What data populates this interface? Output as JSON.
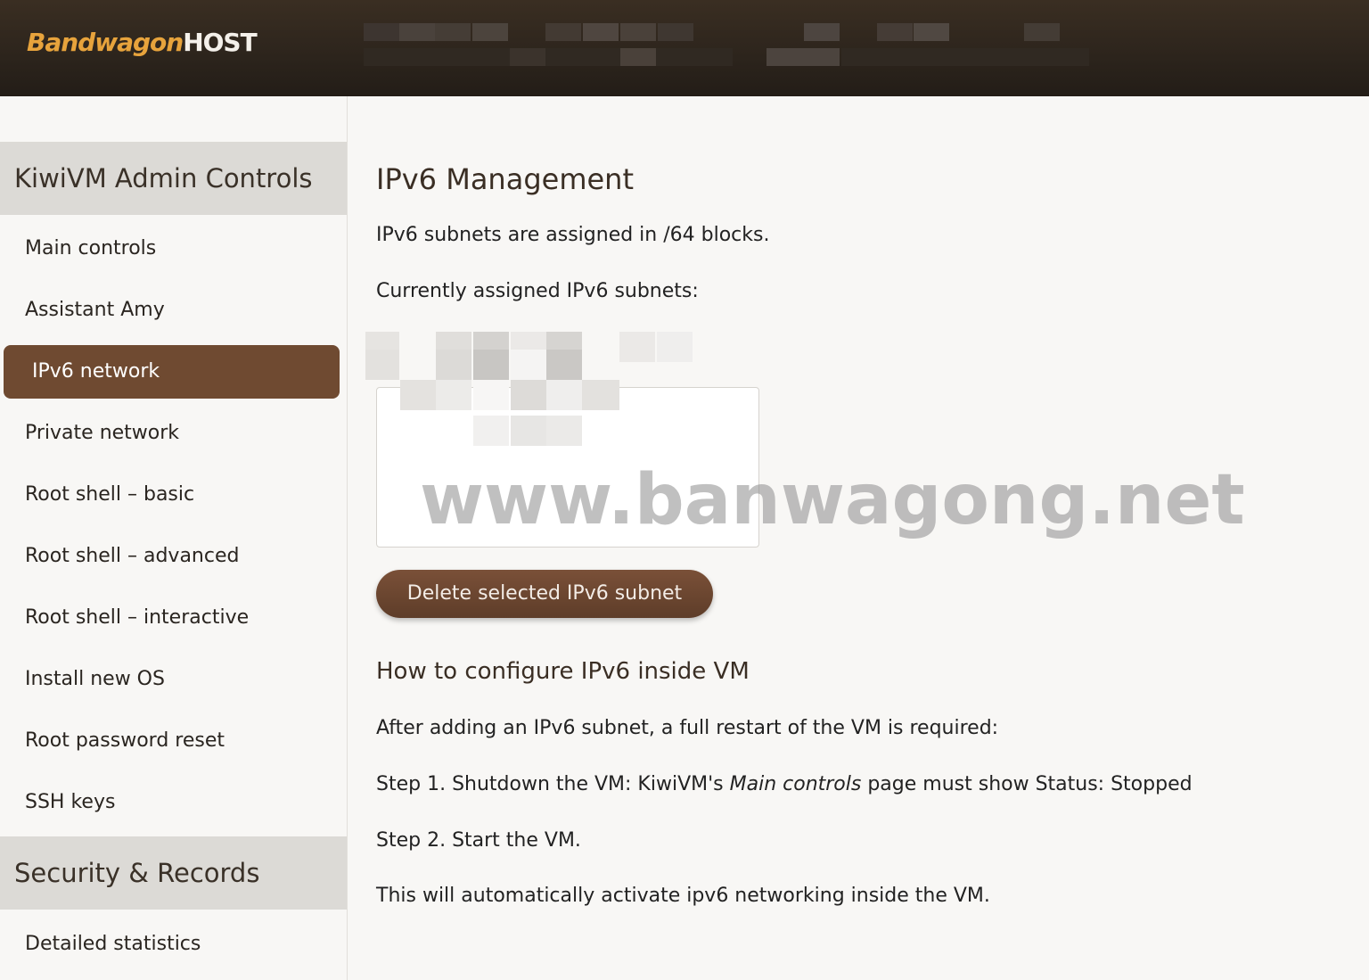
{
  "header": {
    "logo_part1": "Bandwagon",
    "logo_part2": "HOST"
  },
  "sidebar": {
    "section1_title": "KiwiVM Admin Controls",
    "items": [
      {
        "label": "Main controls"
      },
      {
        "label": "Assistant Amy"
      },
      {
        "label": "IPv6 network",
        "active": true
      },
      {
        "label": "Private network"
      },
      {
        "label": "Root shell – basic"
      },
      {
        "label": "Root shell – advanced"
      },
      {
        "label": "Root shell – interactive"
      },
      {
        "label": "Install new OS"
      },
      {
        "label": "Root password reset"
      },
      {
        "label": "SSH keys"
      }
    ],
    "section2_title": "Security & Records",
    "items2": [
      {
        "label": "Detailed statistics"
      }
    ]
  },
  "main": {
    "title": "IPv6 Management",
    "intro": "IPv6 subnets are assigned in /64 blocks.",
    "assigned_label": "Currently assigned IPv6 subnets:",
    "delete_button": "Delete selected IPv6 subnet",
    "howto_title": "How to configure IPv6 inside VM",
    "howto_intro": "After adding an IPv6 subnet, a full restart of the VM is required:",
    "step1_prefix": "Step 1. Shutdown the VM: KiwiVM's ",
    "step1_em": "Main controls",
    "step1_suffix": " page must show Status: Stopped",
    "step2": "Step 2. Start the VM.",
    "closing": "This will automatically activate ipv6 networking inside the VM."
  },
  "watermark": "www.banwagong.net",
  "colors": {
    "accent": "#6f4a31",
    "header_bg": "#2c241c",
    "logo_orange": "#e7a33c"
  }
}
